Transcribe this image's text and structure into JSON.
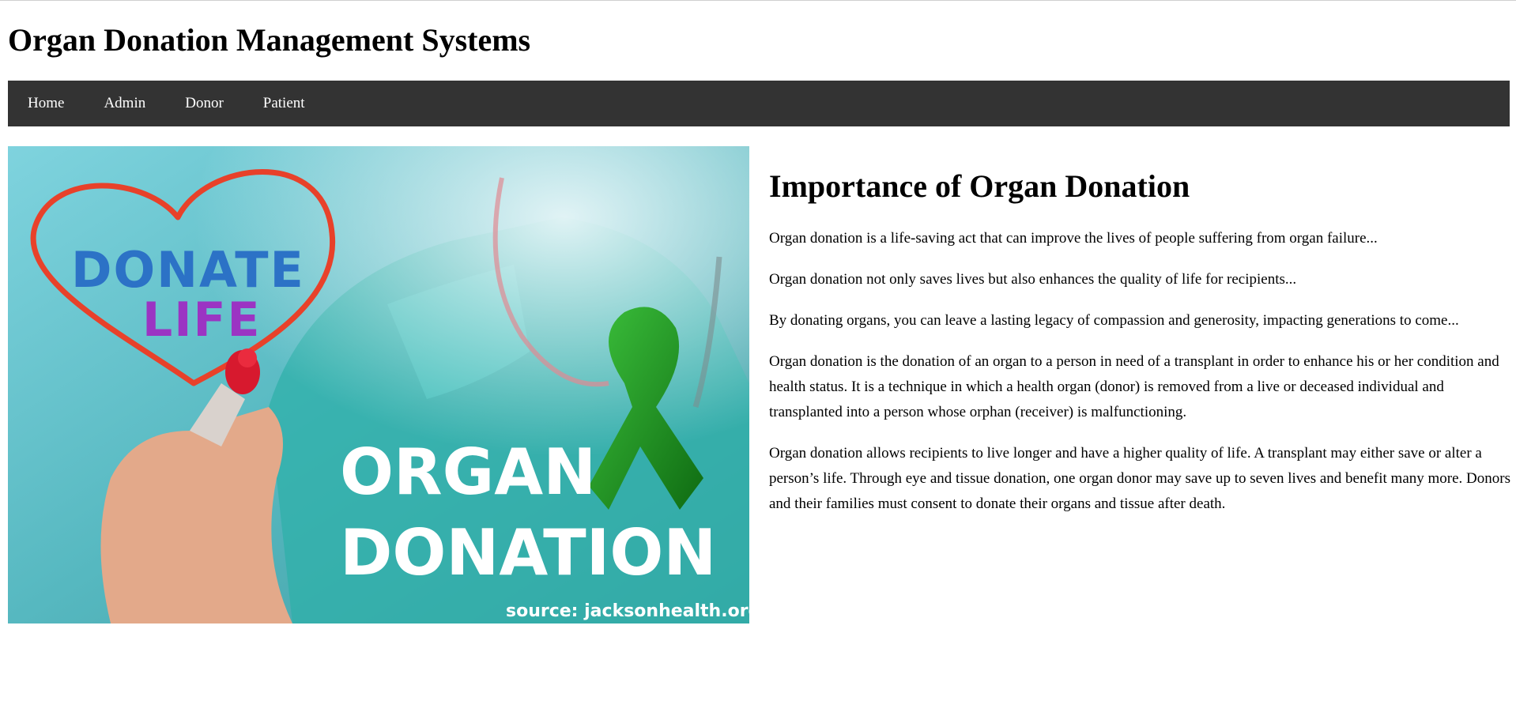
{
  "header": {
    "title": "Organ Donation Management Systems"
  },
  "nav": {
    "items": [
      {
        "label": "Home"
      },
      {
        "label": "Admin"
      },
      {
        "label": "Donor"
      },
      {
        "label": "Patient"
      }
    ],
    "background": "#333333"
  },
  "hero_image": {
    "heart_text_line1": "DONATE",
    "heart_text_line2": "LIFE",
    "title_line1": "ORGAN",
    "title_line2": "DONATION",
    "source": "source: jacksonhealth.org",
    "ribbon_color": "#1e8a1e",
    "heart_color": "#e8412a"
  },
  "main": {
    "heading": "Importance of Organ Donation",
    "paragraphs": [
      "Organ donation is a life-saving act that can improve the lives of people suffering from organ failure...",
      "Organ donation not only saves lives but also enhances the quality of life for recipients...",
      "By donating organs, you can leave a lasting legacy of compassion and generosity, impacting generations to come...",
      "Organ donation is the donation of an organ to a person in need of a transplant in order to enhance his or her condition and health status. It is a technique in which a health organ (donor) is removed from a live or deceased individual and transplanted into a person whose orphan (receiver) is malfunctioning.",
      "Organ donation allows recipients to live longer and have a higher quality of life. A transplant may either save or alter a person’s life. Through eye and tissue donation, one organ donor may save up to seven lives and benefit many more. Donors and their families must consent to donate their organs and tissue after death."
    ]
  }
}
